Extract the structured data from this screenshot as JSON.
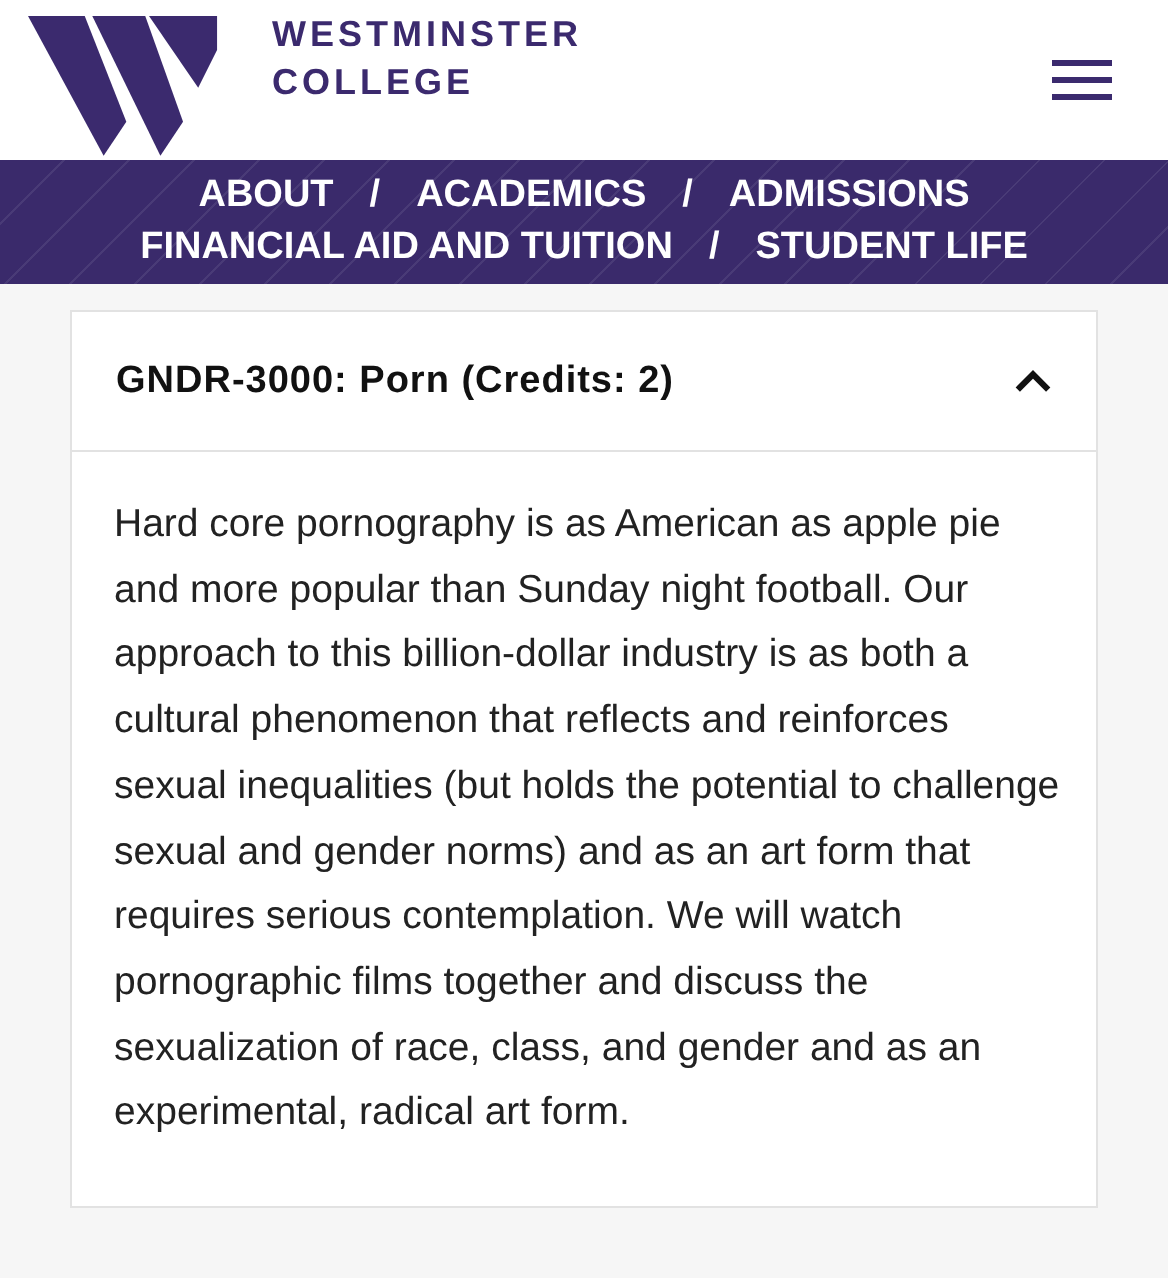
{
  "header": {
    "logo_line_1": "WESTMINSTER",
    "logo_line_2": "COLLEGE"
  },
  "nav": [
    [
      "ABOUT",
      "ACADEMICS",
      "ADMISSIONS"
    ],
    [
      "FINANCIAL AID AND TUITION",
      "STUDENT LIFE"
    ]
  ],
  "nav_separator": "/",
  "course": {
    "title": "GNDR-3000: Porn (Credits: 2)",
    "expanded": true,
    "description": "Hard core pornography is as American as apple pie and more popular than Sunday night football. Our approach to this billion-dollar industry is as both a cultural phenomenon that reflects and reinforces sexual inequalities (but holds the potential to challenge sexual and gender norms) and as an art form that requires serious contemplation. We will watch pornographic films together and discuss the sexualization of race, class, and gender and as an experimental, radical art form."
  }
}
